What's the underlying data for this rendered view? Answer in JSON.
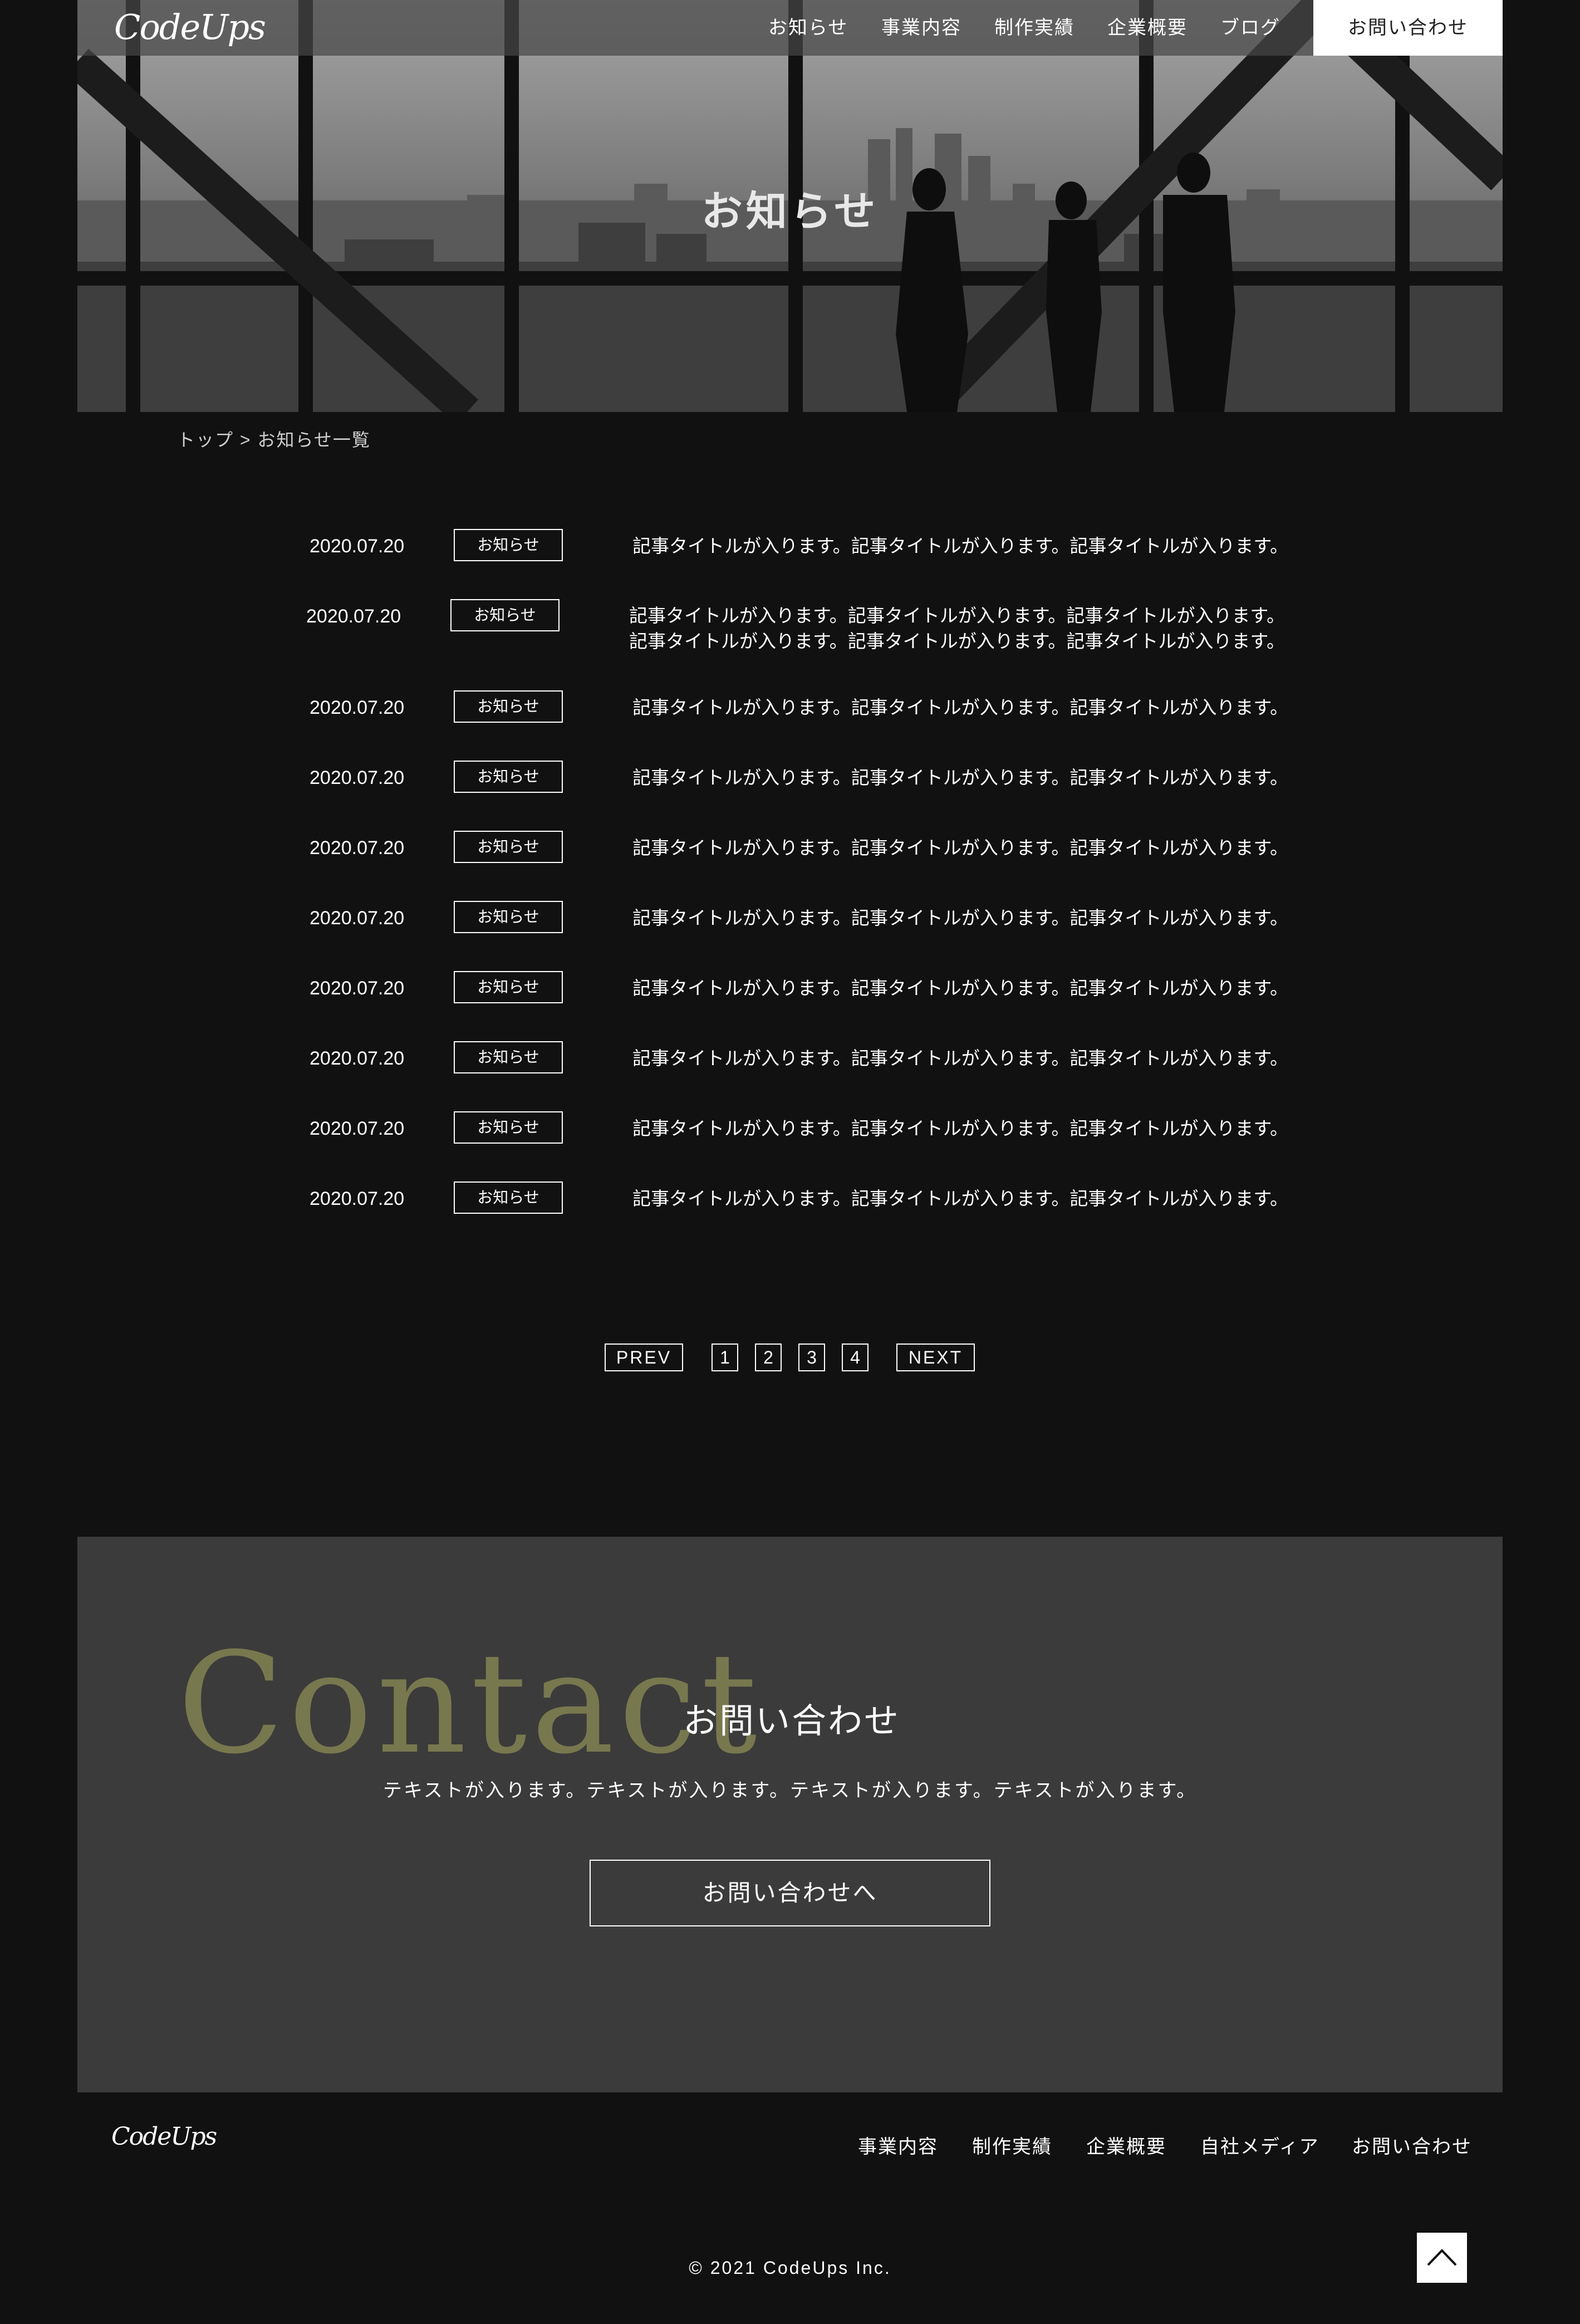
{
  "header": {
    "logo": "CodeUps",
    "nav": [
      "お知らせ",
      "事業内容",
      "制作実績",
      "企業概要",
      "ブログ"
    ],
    "contact_button": "お問い合わせ"
  },
  "hero": {
    "title": "お知らせ"
  },
  "breadcrumb": "トップ > お知らせ一覧",
  "news": [
    {
      "date": "2020.07.20",
      "tag": "お知らせ",
      "title": "記事タイトルが入ります。記事タイトルが入ります。記事タイトルが入ります。"
    },
    {
      "date": "2020.07.20",
      "tag": "お知らせ",
      "title": "記事タイトルが入ります。記事タイトルが入ります。記事タイトルが入ります。",
      "title2": "記事タイトルが入ります。記事タイトルが入ります。記事タイトルが入ります。"
    },
    {
      "date": "2020.07.20",
      "tag": "お知らせ",
      "title": "記事タイトルが入ります。記事タイトルが入ります。記事タイトルが入ります。"
    },
    {
      "date": "2020.07.20",
      "tag": "お知らせ",
      "title": "記事タイトルが入ります。記事タイトルが入ります。記事タイトルが入ります。"
    },
    {
      "date": "2020.07.20",
      "tag": "お知らせ",
      "title": "記事タイトルが入ります。記事タイトルが入ります。記事タイトルが入ります。"
    },
    {
      "date": "2020.07.20",
      "tag": "お知らせ",
      "title": "記事タイトルが入ります。記事タイトルが入ります。記事タイトルが入ります。"
    },
    {
      "date": "2020.07.20",
      "tag": "お知らせ",
      "title": "記事タイトルが入ります。記事タイトルが入ります。記事タイトルが入ります。"
    },
    {
      "date": "2020.07.20",
      "tag": "お知らせ",
      "title": "記事タイトルが入ります。記事タイトルが入ります。記事タイトルが入ります。"
    },
    {
      "date": "2020.07.20",
      "tag": "お知らせ",
      "title": "記事タイトルが入ります。記事タイトルが入ります。記事タイトルが入ります。"
    },
    {
      "date": "2020.07.20",
      "tag": "お知らせ",
      "title": "記事タイトルが入ります。記事タイトルが入ります。記事タイトルが入ります。"
    }
  ],
  "pagination": {
    "prev": "PREV",
    "pages": [
      "1",
      "2",
      "3",
      "4"
    ],
    "next": "NEXT"
  },
  "contact": {
    "heading_en": "Contact",
    "heading_ja": "お問い合わせ",
    "text": "テキストが入ります。テキストが入ります。テキストが入ります。テキストが入ります。",
    "button": "お問い合わせへ"
  },
  "footer": {
    "logo": "CodeUps",
    "nav": [
      "事業内容",
      "制作実績",
      "企業概要",
      "自社メディア",
      "お問い合わせ"
    ],
    "copyright": "© 2021 CodeUps Inc."
  },
  "colors": {
    "background": "#111111",
    "contact_bg": "#3b3b3b",
    "contact_accent": "#78784f"
  },
  "icons": {
    "to_top": "chevron-up-icon"
  }
}
